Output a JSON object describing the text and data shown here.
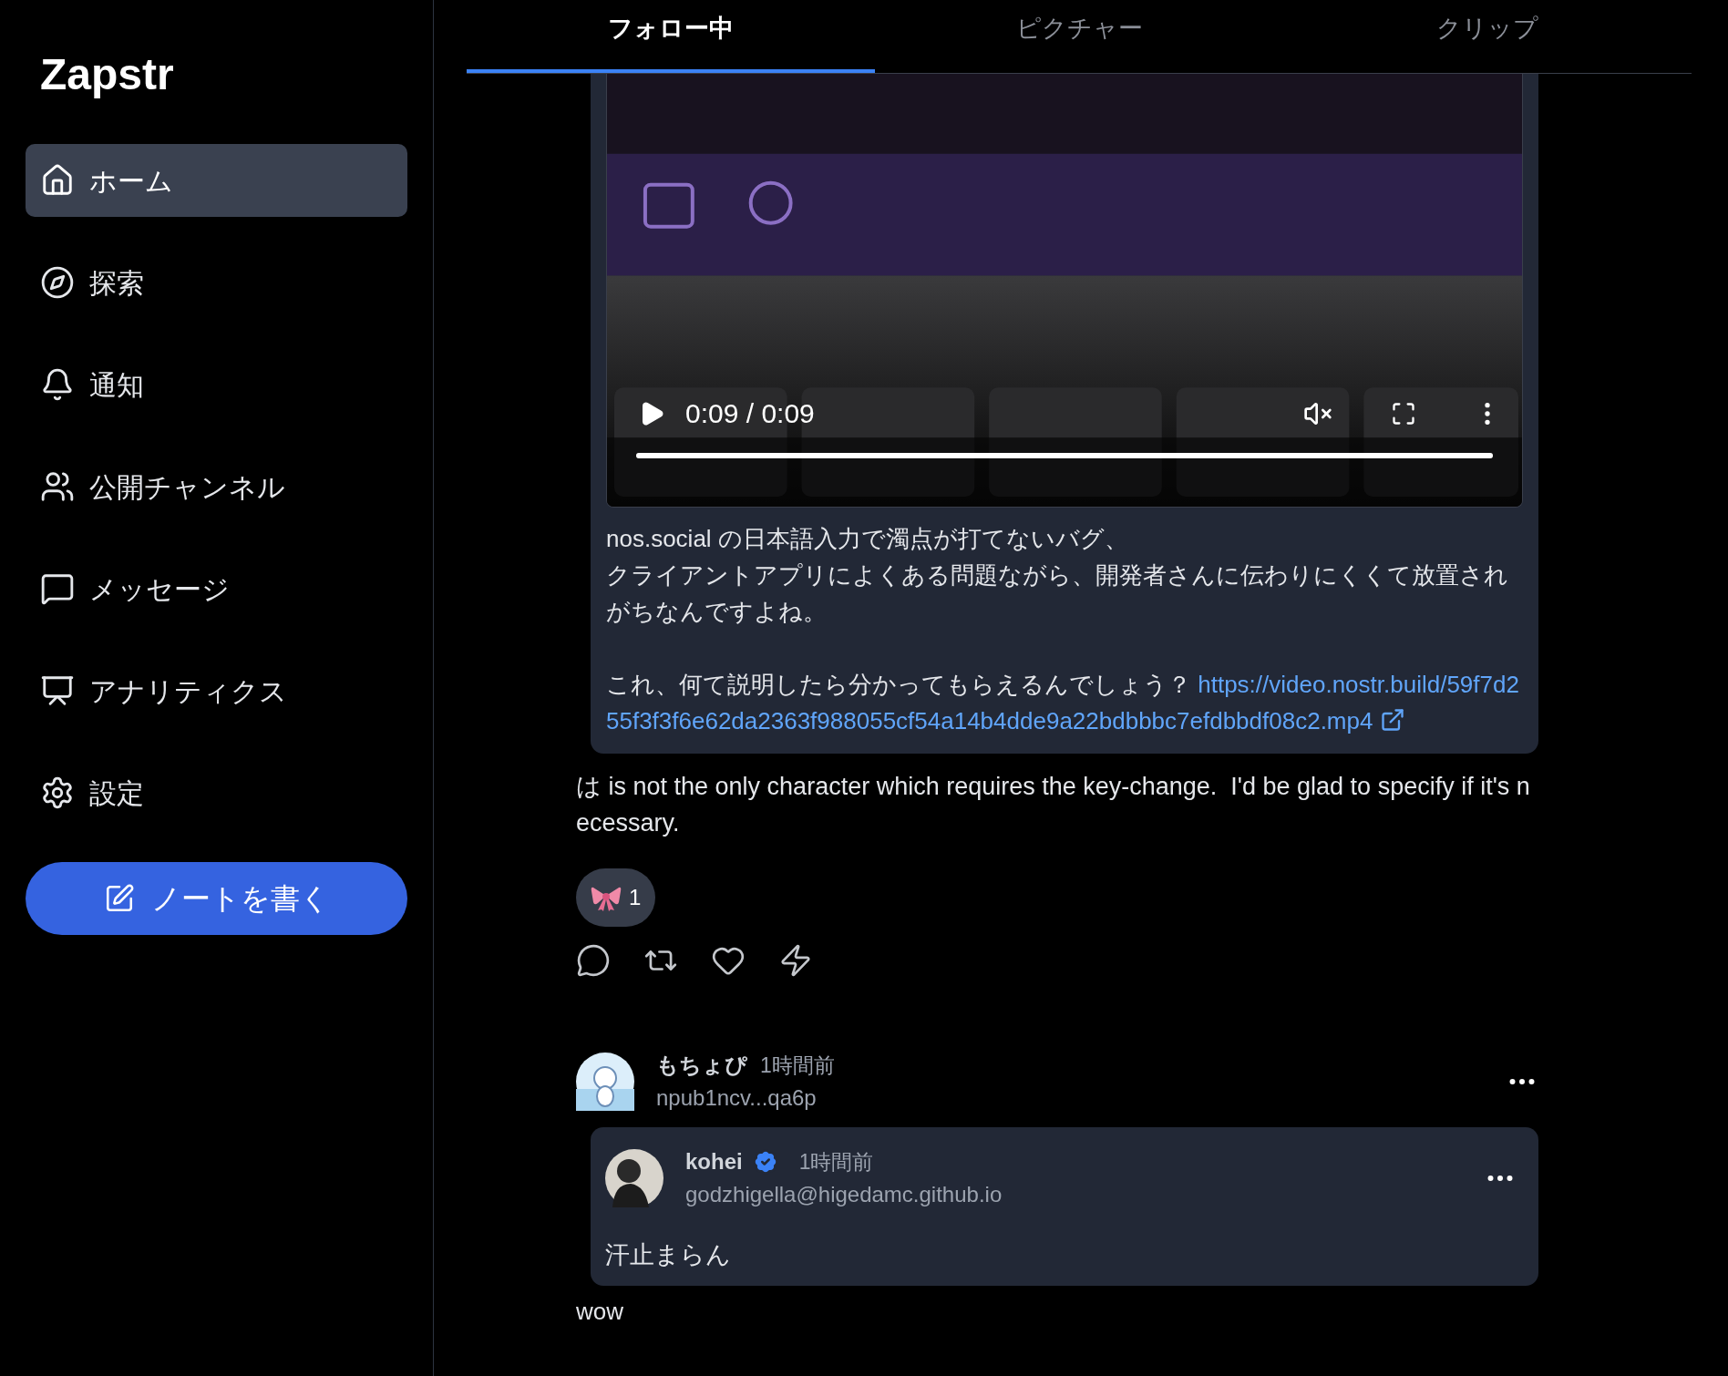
{
  "sidebar": {
    "logo": "Zapstr",
    "items": [
      {
        "kind": "home",
        "label": "ホーム",
        "selected": true
      },
      {
        "kind": "explore",
        "label": "探索",
        "selected": false
      },
      {
        "kind": "notifications",
        "label": "通知",
        "selected": false
      },
      {
        "kind": "channels",
        "label": "公開チャンネル",
        "selected": false
      },
      {
        "kind": "messages",
        "label": "メッセージ",
        "selected": false
      },
      {
        "kind": "analytics",
        "label": "アナリティクス",
        "selected": false
      },
      {
        "kind": "settings",
        "label": "設定",
        "selected": false
      }
    ],
    "compose_button": "ノートを書く"
  },
  "tabs": [
    {
      "label": "フォロー中",
      "selected": true
    },
    {
      "label": "ピクチャー",
      "selected": false
    },
    {
      "label": "クリップ",
      "selected": false
    }
  ],
  "feed": [
    {
      "quoted_note": {
        "video": {
          "time": "0:09 / 0:09",
          "level": 1,
          "muted": true
        },
        "paragraphs": [
          "nos.social の日本語入力で濁点が打てないバグ、",
          "クライアントアプリによくある問題ながら、開発者さんに伝わりにくくて放置されがちなんですよね。",
          "これ、何て説明したら分かってもらえるんでしょう？"
        ],
        "link": "https://video.nostr.build/59f7d255f3f3f6e62da2363f988055cf54a14b4dde9a22bdbbbc7efdbbdf08c2.mp4"
      },
      "text": "は is not the only character which requires the key-change.  I'd be glad to specify if it's necessary.",
      "reaction_count": "1"
    },
    {
      "author": "もちょぴ",
      "time": "1時間前",
      "handle": "npub1ncv...qa6p",
      "quoted_note": {
        "author": "kohei",
        "verified": true,
        "time": "1時間前",
        "handle": "godzhigella@higedamc.github.io",
        "text": "汗止まらん"
      },
      "text": "wow"
    }
  ]
}
